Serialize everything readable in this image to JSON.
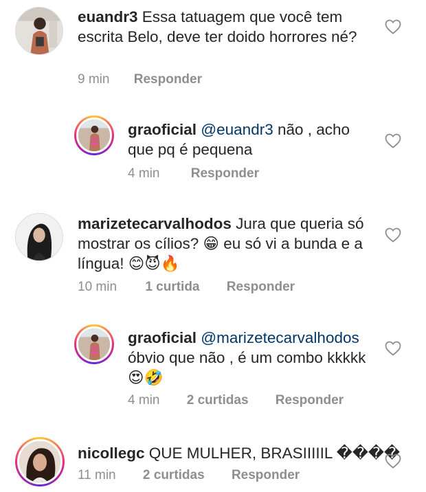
{
  "comments": [
    {
      "username": "euandr3",
      "text": "Essa tatuagem que você tem escrita Belo, deve ter doido horrores né?",
      "time": "9 min",
      "likes": "",
      "reply": "Responder",
      "avatar_icon": "user-photo-avatar",
      "story_ring": false
    },
    {
      "username": "graoficial",
      "mention": "@euandr3",
      "text": "não , acho que pq é pequena",
      "time": "4 min",
      "likes": "",
      "reply": "Responder",
      "avatar_icon": "user-photo-avatar",
      "story_ring": true
    },
    {
      "username": "marizetecarvalhodos",
      "text": "Jura que queria só mostrar os cílios? 😁 eu só vi a bunda e a língua! 😊😈🔥",
      "time": "10 min",
      "likes": "1 curtida",
      "reply": "Responder",
      "avatar_icon": "user-photo-avatar",
      "story_ring": false
    },
    {
      "username": "graoficial",
      "mention": "@marizetecarvalhodos",
      "text": "óbvio que não , é um combo kkkkk 😍🤣",
      "time": "4 min",
      "likes": "2 curtidas",
      "reply": "Responder",
      "avatar_icon": "user-photo-avatar",
      "story_ring": true
    },
    {
      "username": "nicollegc",
      "text": "QUE MULHER, BRASIIIIIL ����",
      "time": "11 min",
      "likes": "2 curtidas",
      "reply": "Responder",
      "avatar_icon": "user-photo-avatar",
      "story_ring": true
    }
  ],
  "like_icon": "heart-outline-icon",
  "colors": {
    "text": "#262626",
    "meta": "#8e8e8e",
    "mention": "#00376b"
  }
}
